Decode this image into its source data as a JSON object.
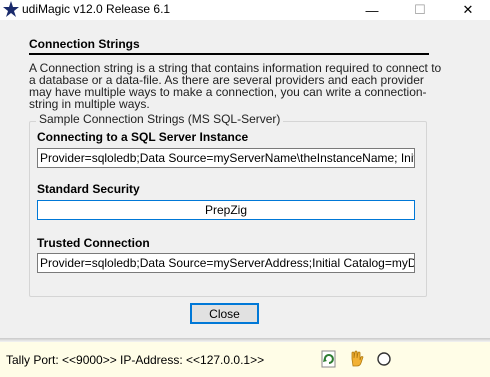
{
  "window": {
    "title": "udiMagic v12.0 Release 6.1",
    "controls": {
      "minimize": "—",
      "maximize": "☐",
      "close": "✕"
    }
  },
  "dialog": {
    "heading": "Connection Strings",
    "description": "A Connection string is a string that contains information required to connect to a database or a data-file. As there are several providers and each provider may have multiple ways to make a connection, you can write a connection-string in multiple ways.",
    "group_caption": "Sample Connection Strings (MS SQL-Server)",
    "sections": [
      {
        "heading": "Connecting to a SQL Server Instance",
        "value": "Provider=sqloledb;Data Source=myServerName\\theInstanceName; Initial Catalog=myDataBase;"
      },
      {
        "heading": "Standard Security",
        "value": "PrepZig"
      },
      {
        "heading": "Trusted Connection",
        "value": "Provider=sqloledb;Data Source=myServerAddress;Initial Catalog=myDataBase;Integrated Security=SSPI;"
      }
    ],
    "close_label": "Close"
  },
  "statusbar": {
    "tally_port": "Tally Port: <<9000>>",
    "ip_address": "IP-Address: <<127.0.0.1>>",
    "icons": [
      "refresh-icon",
      "hand-icon",
      "circle-icon"
    ]
  }
}
